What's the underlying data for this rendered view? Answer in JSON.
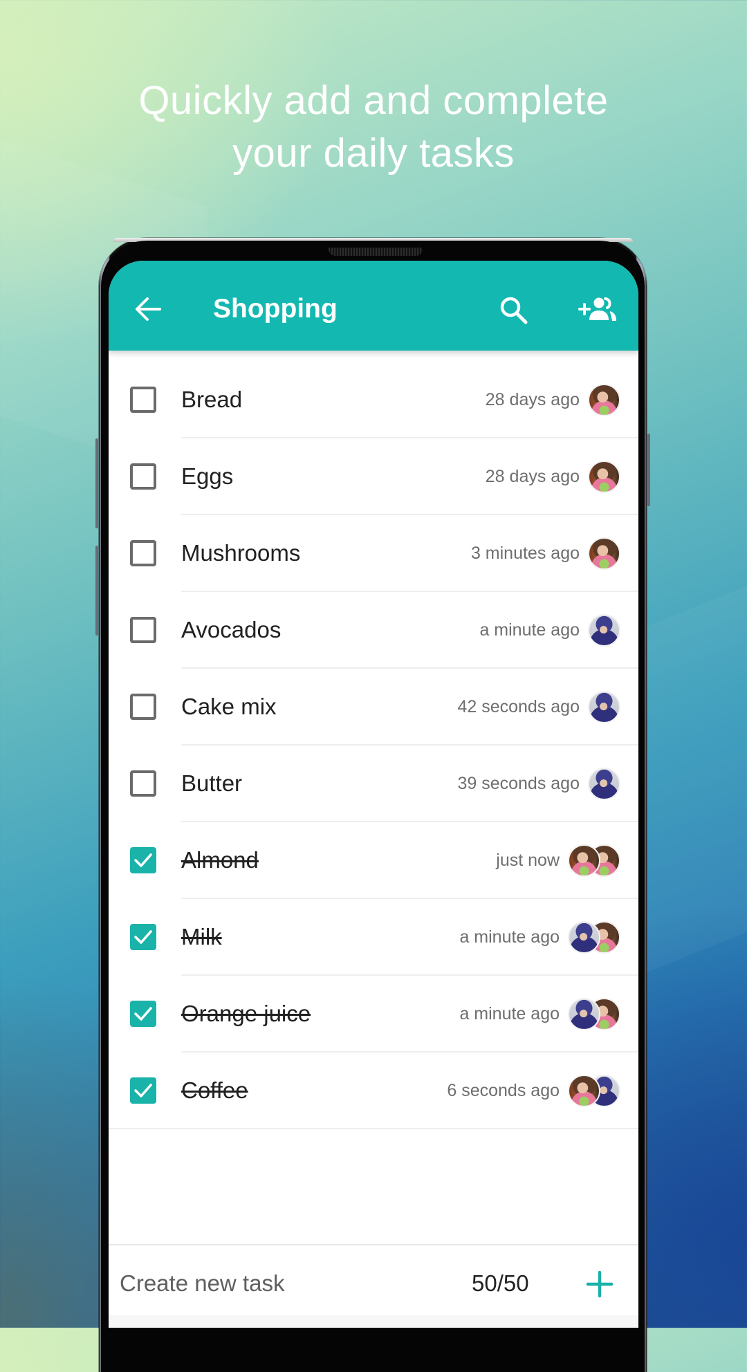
{
  "headline": {
    "line1": "Quickly add and complete",
    "line2": "your daily tasks"
  },
  "app": {
    "title": "Shopping",
    "accent_color": "#13b8b1",
    "icons": {
      "back": "arrow-left-icon",
      "search": "search-icon",
      "add_people": "group-add-icon",
      "add_task": "plus-icon"
    }
  },
  "tasks": [
    {
      "label": "Bread",
      "time": "28 days ago",
      "done": false,
      "avatars": [
        "girl"
      ]
    },
    {
      "label": "Eggs",
      "time": "28 days ago",
      "done": false,
      "avatars": [
        "girl"
      ]
    },
    {
      "label": "Mushrooms",
      "time": "3 minutes ago",
      "done": false,
      "avatars": [
        "girl"
      ]
    },
    {
      "label": "Avocados",
      "time": "a minute ago",
      "done": false,
      "avatars": [
        "boy"
      ]
    },
    {
      "label": "Cake mix",
      "time": "42 seconds ago",
      "done": false,
      "avatars": [
        "boy"
      ]
    },
    {
      "label": "Butter",
      "time": "39 seconds ago",
      "done": false,
      "avatars": [
        "boy"
      ]
    },
    {
      "label": "Almond",
      "time": "just now",
      "done": true,
      "avatars": [
        "girl",
        "girl"
      ]
    },
    {
      "label": "Milk",
      "time": "a minute ago",
      "done": true,
      "avatars": [
        "boy",
        "girl"
      ]
    },
    {
      "label": "Orange juice",
      "time": "a minute ago",
      "done": true,
      "avatars": [
        "boy",
        "girl"
      ]
    },
    {
      "label": "Coffee",
      "time": "6 seconds ago",
      "done": true,
      "avatars": [
        "girl",
        "boy"
      ]
    }
  ],
  "composer": {
    "placeholder": "Create new task",
    "value": "",
    "counter": "50/50"
  }
}
